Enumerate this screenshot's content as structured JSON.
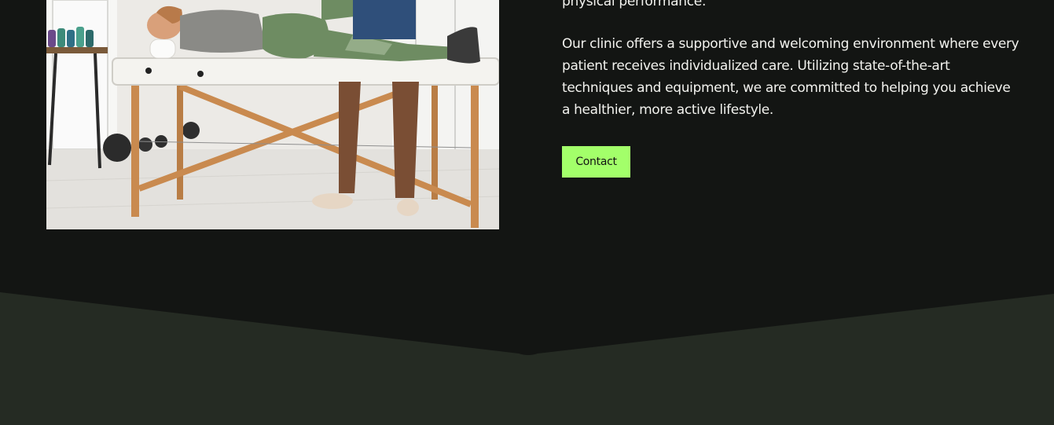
{
  "intro": {
    "tail_text": "physical performance.",
    "paragraph": "Our clinic offers a supportive and welcoming environment where every patient receives individualized care. Utilizing state-of-the-art techniques and equipment, we are committed to helping you achieve a healthier, more active lifestyle."
  },
  "cta": {
    "contact_label": "Contact"
  },
  "colors": {
    "background": "#131513",
    "accent": "#a3ff6a",
    "footer_band": "#252b23",
    "text": "#f2f2ee"
  },
  "icons": {
    "photo": "physiotherapy-session-photo"
  }
}
